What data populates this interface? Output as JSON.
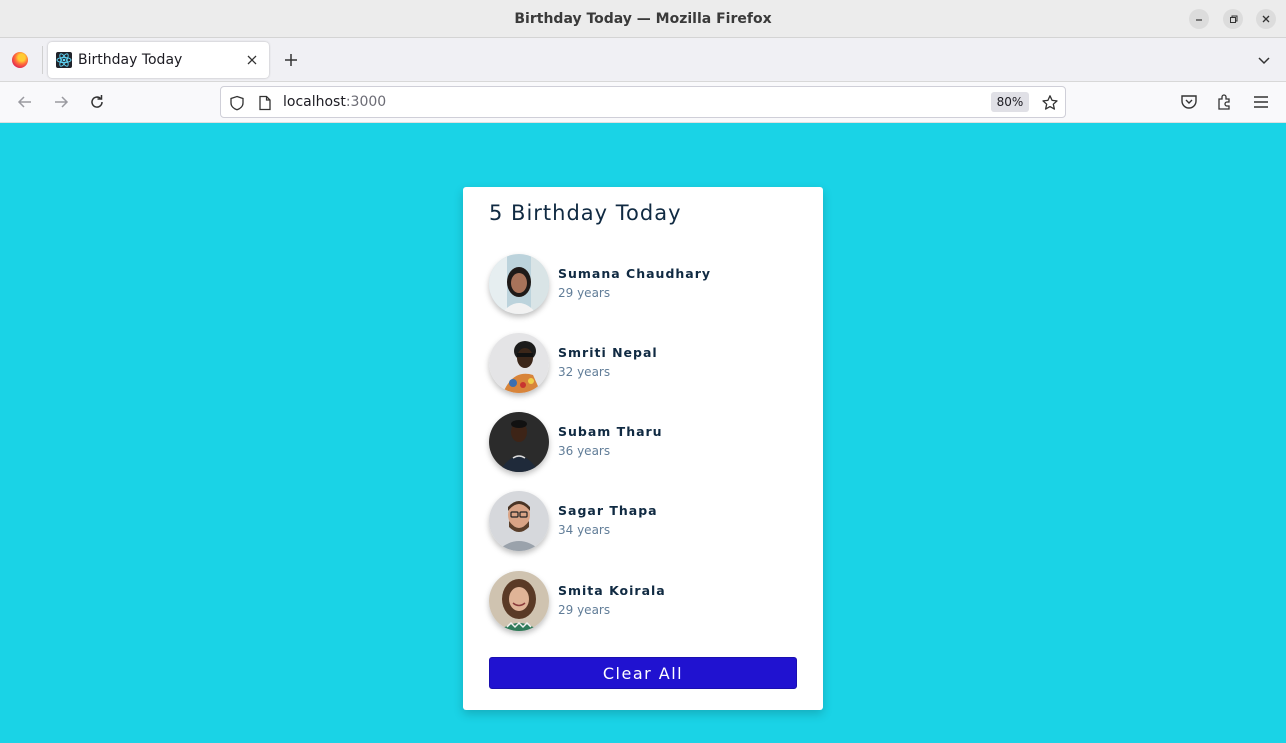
{
  "window": {
    "title": "Birthday Today — Mozilla Firefox"
  },
  "tabs": [
    {
      "label": "Birthday Today"
    }
  ],
  "address_bar": {
    "host": "localhost",
    "port": ":3000",
    "zoom": "80%"
  },
  "main": {
    "heading": "5 Birthday Today",
    "people": [
      {
        "name": "Sumana Chaudhary",
        "age": "29 years"
      },
      {
        "name": "Smriti Nepal",
        "age": "32 years"
      },
      {
        "name": "Subam Tharu",
        "age": "36 years"
      },
      {
        "name": "Sagar Thapa",
        "age": "34 years"
      },
      {
        "name": "Smita Koirala",
        "age": "29 years"
      }
    ],
    "clear_label": "Clear All"
  },
  "colors": {
    "page_background": "#1ad3e6",
    "button_background": "#2012d0",
    "heading_text": "#102a42",
    "subtext": "#617d98"
  }
}
